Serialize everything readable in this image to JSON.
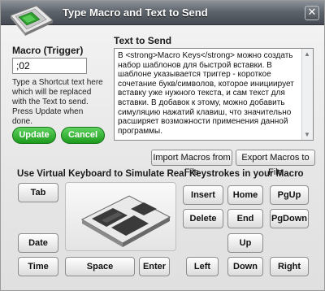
{
  "window": {
    "title": "Type Macro and Text to Send",
    "close_glyph": "✕",
    "icon": "keyboard-app-icon"
  },
  "macro": {
    "label": "Macro (Trigger)",
    "value": ";02",
    "hint": "Type a Shortcut text here which will be replaced with the Text to send. Press Update when done.",
    "update_label": "Update",
    "cancel_label": "Cancel"
  },
  "text_to_send": {
    "label": "Text to Send",
    "content": "В <strong>Macro Keys</strong> можно создать набор шаблонов для быстрой вставки. В шаблоне указывается триггер - короткое сочетание букв/символов, которое инициирует вставку уже нужного текста, и сам текст для вставки. В добавок к этому, можно добавить симуляцию нажатий клавиш, что значительно расширяет возможности применения данной программы."
  },
  "import_export": {
    "import_label": "Import Macros from File",
    "export_label": "Export Macros to File"
  },
  "virtual_keyboard": {
    "heading": "Use Virtual Keyboard to Simulate Real Keystrokes in your Macro",
    "keys": {
      "tab": "Tab",
      "date": "Date",
      "time": "Time",
      "space": "Space",
      "enter": "Enter",
      "insert": "Insert",
      "home": "Home",
      "pgup": "PgUp",
      "delete": "Delete",
      "end": "End",
      "pgdown": "PgDown",
      "up": "Up",
      "left": "Left",
      "down": "Down",
      "right": "Right"
    }
  },
  "colors": {
    "titlebar": "#5f656d",
    "green_button": "#2faa2f",
    "window_bg": "#ececec"
  }
}
